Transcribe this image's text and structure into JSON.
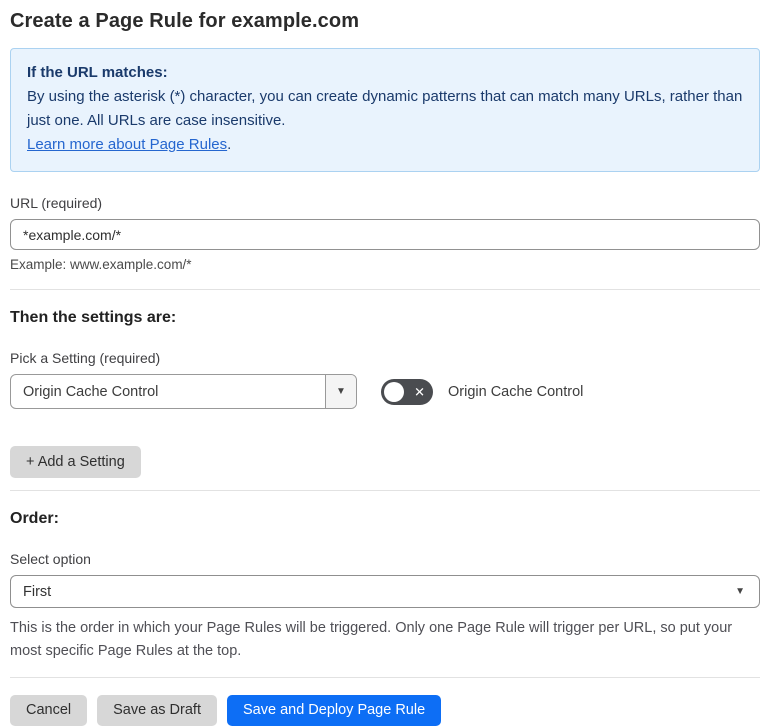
{
  "page_title": "Create a Page Rule for example.com",
  "colors": {
    "accent_blue": "#0d6ef5",
    "info_background": "#e9f3fd",
    "info_border": "#abd2f1",
    "info_text": "#1a3a6b",
    "link_blue": "#2566cf",
    "toggle_off_background": "#4a4c50",
    "button_gray": "#d7d7d7"
  },
  "info_box": {
    "heading": "If the URL matches:",
    "body": "By using the asterisk (*) character, you can create dynamic patterns that can match many URLs, rather than just one. All URLs are case insensitive.",
    "link_label": "Learn more about Page Rules",
    "link_suffix": "."
  },
  "url_field": {
    "label": "URL (required)",
    "value": "*example.com/*",
    "example": "Example: www.example.com/*"
  },
  "settings_section": {
    "heading": "Then the settings are:",
    "picker_label": "Pick a Setting (required)",
    "picker_value": "Origin Cache Control",
    "picker_chevron": "▼",
    "toggle": {
      "state": "off",
      "off_glyph": "✕",
      "label": "Origin Cache Control"
    },
    "add_button_label": "+ Add a Setting"
  },
  "order_section": {
    "heading": "Order:",
    "select_label": "Select option",
    "select_value": "First",
    "select_chevron": "▼",
    "help_text": "This is the order in which your Page Rules will be triggered. Only one Page Rule will trigger per URL, so put your most specific Page Rules at the top."
  },
  "footer": {
    "cancel_label": "Cancel",
    "save_draft_label": "Save as Draft",
    "save_deploy_label": "Save and Deploy Page Rule"
  }
}
